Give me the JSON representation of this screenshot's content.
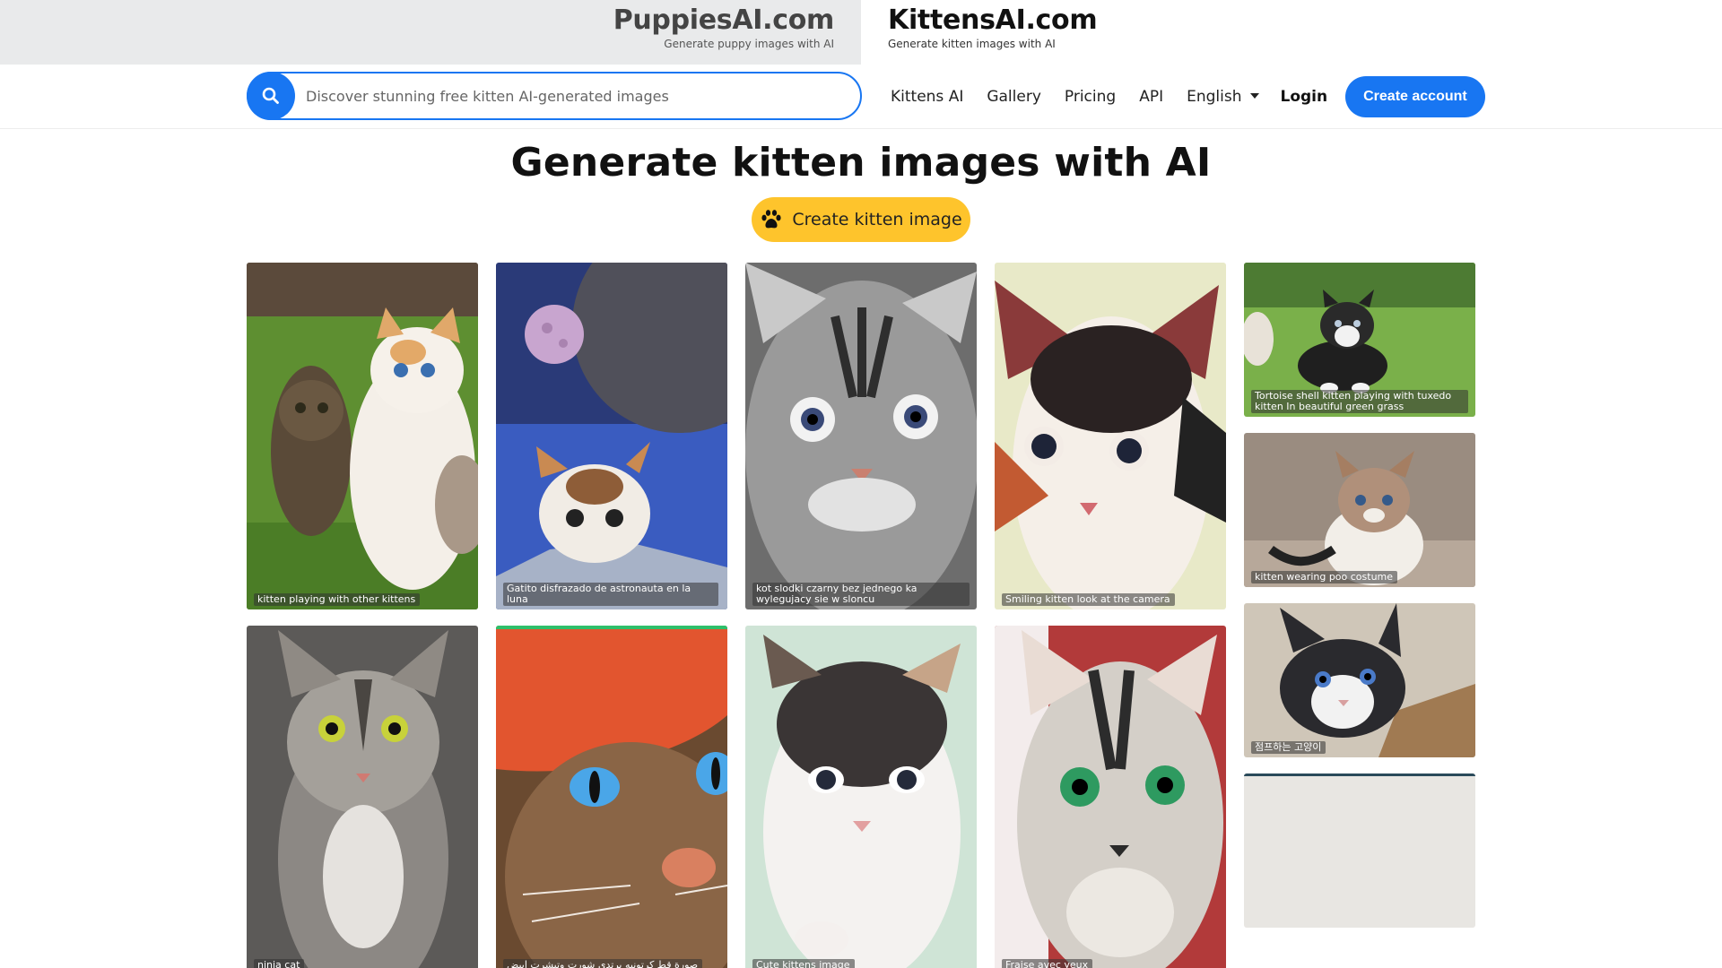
{
  "sites": {
    "puppies": {
      "name": "PuppiesAI.com",
      "tagline": "Generate puppy images with AI"
    },
    "kittens": {
      "name": "KittensAI.com",
      "tagline": "Generate kitten images with AI"
    }
  },
  "search": {
    "placeholder": "Discover stunning free kitten AI-generated images",
    "icon": "search-icon"
  },
  "nav": {
    "links": [
      "Kittens AI",
      "Gallery",
      "Pricing",
      "API"
    ],
    "language": "English",
    "login": "Login",
    "create_account": "Create account"
  },
  "hero": {
    "title": "Generate kitten images with AI",
    "cta": "Create kitten image",
    "cta_icon": "paw-icon"
  },
  "colors": {
    "primary": "#1876f2",
    "cta": "#fec42c"
  },
  "gallery": [
    {
      "caption": "kitten playing with other kittens"
    },
    {
      "caption": "Gatito disfrazado de astronauta en la luna"
    },
    {
      "caption": "kot slodki czarny bez jednego ka wylegujacy sie w sloncu"
    },
    {
      "caption": "Smiling kitten look at the camera"
    },
    {
      "caption": "Tortoise shell kitten playing with tuxedo kitten In beautiful green grass"
    },
    {
      "caption": "kitten wearing poo costume"
    },
    {
      "caption": "ninja cat"
    },
    {
      "caption": "صورة قط كرتونيه يرتدي شورت وتيشرت ابيض"
    },
    {
      "caption": "Cute kittens image"
    },
    {
      "caption": "Fraise avec yeux"
    },
    {
      "caption": "점프하는 고양이"
    }
  ]
}
